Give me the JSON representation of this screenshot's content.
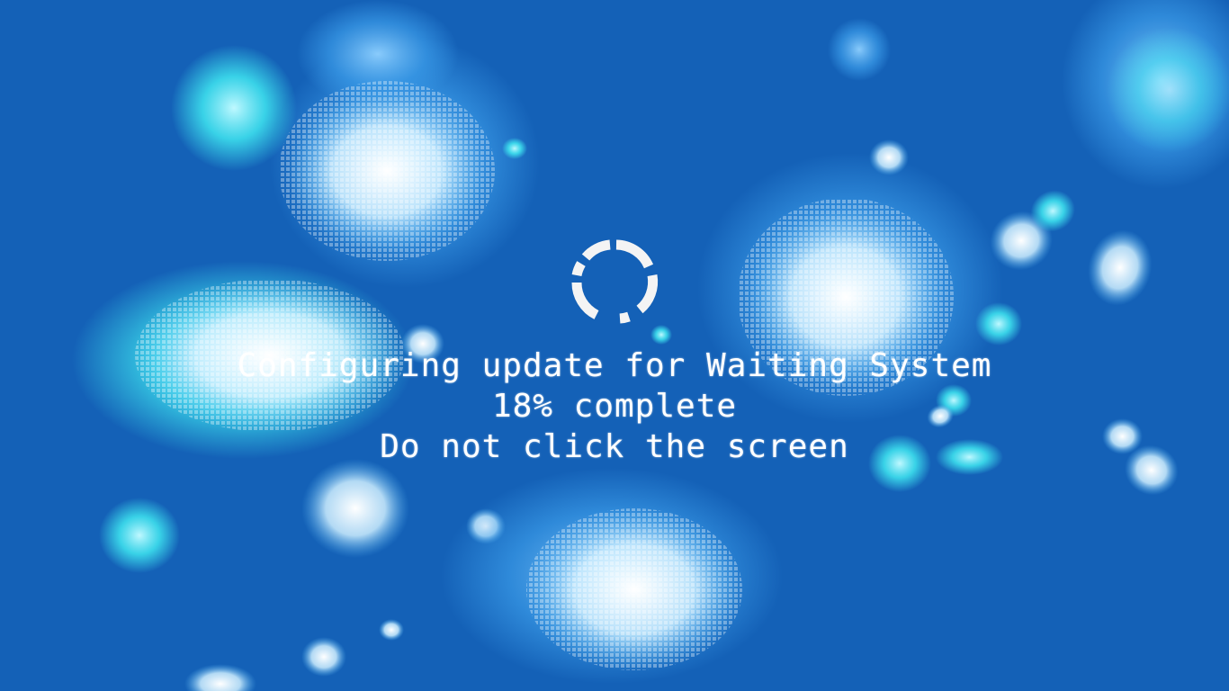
{
  "status": {
    "line1": "Configuring update for Waiting System",
    "line2": "18% complete",
    "line3": "Do not click the screen",
    "progress_percent": 18
  },
  "icons": {
    "spinner": "loading-spinner-icon",
    "particles": "snowflake-particle-icon"
  },
  "colors": {
    "background": "#1461b7",
    "text": "#ffffff",
    "particle_light": "#ffffff",
    "particle_cyan": "#3fe6f0",
    "particle_blue": "#3a9be8"
  }
}
